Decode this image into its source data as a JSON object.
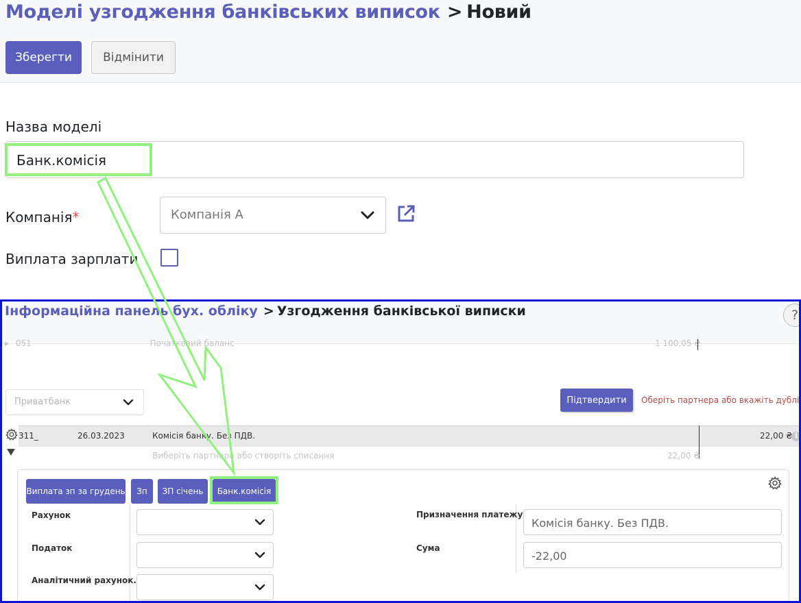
{
  "form": {
    "breadcrumb": {
      "parent": "Моделі узгодження банківських виписок",
      "separator": ">",
      "current": "Новий"
    },
    "buttons": {
      "save": "Зберегти",
      "cancel": "Відмінити"
    },
    "fields": {
      "name_label": "Назва моделі",
      "name_value": "Банк.комісія",
      "company_label": "Компанія",
      "company_required_mark": "*",
      "company_value": "Компанія А",
      "salary_label": "Виплата зарплати",
      "salary_checked": false
    }
  },
  "inset": {
    "breadcrumb": {
      "parent": "Інформаційна панель бух. обліку",
      "separator": ">",
      "current": "Узгодження банківської виписки"
    },
    "help_icon": "?",
    "faded_row": {
      "id": "051",
      "label": "Початковий баланс",
      "amount": "1 100,05 ₴"
    },
    "bank_select_value": "Приватбанк",
    "confirm_button": "Підтвердити",
    "warning": "Оберіть партнера або вкажіть дублікат",
    "statement_line": {
      "id": "311_",
      "date": "26.03.2023",
      "label": "Комісія банку. Без ПДВ.",
      "amount": "22,00 ₴",
      "info_icon": "i"
    },
    "sub_line": {
      "hint": "Виберіть партнера або створіть списання",
      "amount": "22,00 ₴"
    },
    "model_buttons": [
      "Виплата зп за грудень",
      "Зп",
      "ЗП січень",
      "Банк.комісія"
    ],
    "fields": {
      "account_label": "Рахунок",
      "tax_label": "Податок",
      "analytic_label": "Аналітичний рахунок.",
      "purpose_label": "Призначення платежу",
      "purpose_value": "Комісія банку. Без ПДВ.",
      "amount_label": "Сума",
      "amount_value": "-22,00"
    }
  },
  "colors": {
    "primary": "#5a5fbe",
    "highlight": "#92f07e",
    "inset_border": "#0b14d6",
    "warning": "#b94a48"
  }
}
